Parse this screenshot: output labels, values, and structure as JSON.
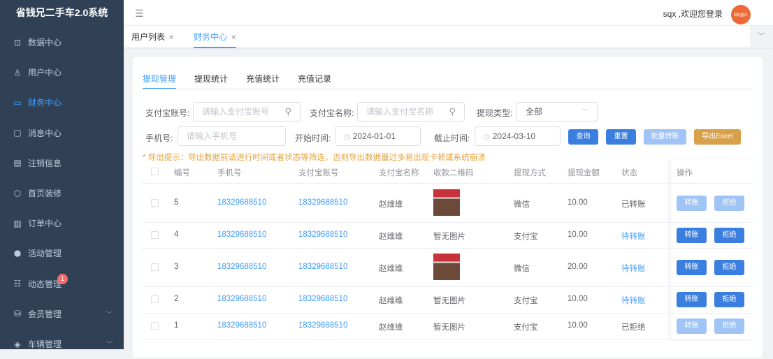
{
  "app": {
    "title": "省钱兄二手车2.0系统"
  },
  "sidebar": {
    "items": [
      {
        "label": "数据中心",
        "icon": "chart-icon"
      },
      {
        "label": "用户中心",
        "icon": "user-icon"
      },
      {
        "label": "财务中心",
        "icon": "wallet-icon",
        "active": true
      },
      {
        "label": "消息中心",
        "icon": "message-icon"
      },
      {
        "label": "注销信息",
        "icon": "clipboard-icon"
      },
      {
        "label": "首页装修",
        "icon": "box-icon"
      },
      {
        "label": "订单中心",
        "icon": "order-icon"
      },
      {
        "label": "活动管理",
        "icon": "hexagon-icon"
      },
      {
        "label": "动态管理",
        "icon": "list-icon",
        "badge": "1"
      },
      {
        "label": "会员管理",
        "icon": "database-icon",
        "expandable": true
      },
      {
        "label": "车辆管理",
        "icon": "layers-icon",
        "expandable": true
      }
    ]
  },
  "header": {
    "welcome": "sqx ,欢迎您登录",
    "avatar_text": "网站图片"
  },
  "page_tabs": [
    {
      "label": "用户列表"
    },
    {
      "label": "财务中心",
      "active": true
    }
  ],
  "sub_tabs": [
    "提现管理",
    "提现统计",
    "充值统计",
    "充值记录"
  ],
  "filters": {
    "alipay_account": {
      "label": "支付宝账号:",
      "placeholder": "请输入支付宝账号"
    },
    "alipay_name": {
      "label": "支付宝名称:",
      "placeholder": "请输入支付宝名称"
    },
    "withdraw_type": {
      "label": "提现类型:",
      "value": "全部"
    },
    "phone": {
      "label": "手机号:",
      "placeholder": "请输入手机号"
    },
    "start_time": {
      "label": "开始时间:",
      "value": "2024-01-01"
    },
    "end_time": {
      "label": "截止时间:",
      "value": "2024-03-10"
    },
    "buttons": {
      "query": "查询",
      "reset": "重置",
      "batch": "批量转账",
      "export": "导出Excel"
    }
  },
  "tip": "* 导出提示：导出数据前请进行时间或者状态等筛选，否则导出数据量过多易出现卡顿或系统崩溃",
  "table": {
    "columns": [
      "编号",
      "手机号",
      "支付宝账号",
      "支付宝名称",
      "收款二维码",
      "提现方式",
      "提现金额",
      "状态",
      "操作"
    ],
    "rows": [
      {
        "id": "5",
        "phone": "18329688510",
        "account": "18329688510",
        "name": "赵维维",
        "qr": "image",
        "method": "微信",
        "amount": "10.00",
        "status": "已转账",
        "pending": false
      },
      {
        "id": "4",
        "phone": "18329688510",
        "account": "18329688510",
        "name": "赵维维",
        "qr": "暂无图片",
        "method": "支付宝",
        "amount": "10.00",
        "status": "待转账",
        "pending": true
      },
      {
        "id": "3",
        "phone": "18329688510",
        "account": "18329688510",
        "name": "赵维维",
        "qr": "image",
        "method": "微信",
        "amount": "20.00",
        "status": "待转账",
        "pending": true
      },
      {
        "id": "2",
        "phone": "18329688510",
        "account": "18329688510",
        "name": "赵维维",
        "qr": "暂无图片",
        "method": "支付宝",
        "amount": "10.00",
        "status": "待转账",
        "pending": true
      },
      {
        "id": "1",
        "phone": "18329688510",
        "account": "18329688510",
        "name": "赵维维",
        "qr": "暂无图片",
        "method": "支付宝",
        "amount": "10.00",
        "status": "已拒绝",
        "pending": false
      }
    ],
    "actions": {
      "transfer": "转账",
      "reject": "拒绝"
    }
  }
}
